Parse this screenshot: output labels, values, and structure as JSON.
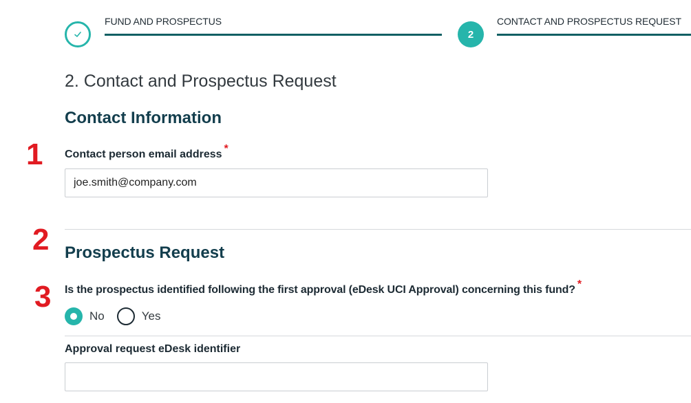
{
  "stepper": {
    "steps": [
      {
        "label": "FUND AND PROSPECTUS",
        "status": "completed",
        "icon": "check-icon"
      },
      {
        "label": "CONTACT AND PROSPECTUS REQUEST",
        "status": "current",
        "number": "2"
      }
    ]
  },
  "page_title": "2. Contact and Prospectus Request",
  "contact": {
    "heading": "Contact Information",
    "email_label": "Contact person email address",
    "email_value": "joe.smith@company.com",
    "required_mark": "*"
  },
  "prospectus": {
    "heading": "Prospectus Request",
    "question": "Is the prospectus identified following the first approval (eDesk UCI Approval) concerning this fund?",
    "required_mark": "*",
    "options": [
      {
        "label": "No",
        "selected": true
      },
      {
        "label": "Yes",
        "selected": false
      }
    ],
    "identifier_label": "Approval request eDesk identifier",
    "identifier_value": ""
  },
  "annotations": [
    "1",
    "2",
    "3"
  ],
  "colors": {
    "accent": "#26b5ab",
    "line": "#0f5f63",
    "heading": "#133e4d",
    "annotation": "#e11b22"
  }
}
